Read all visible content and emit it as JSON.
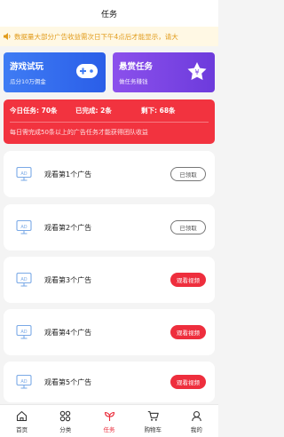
{
  "header": {
    "title": "任务"
  },
  "notice": {
    "text": "数据量大部分广告收益需次日下午4点后才能显示，请大"
  },
  "cards": [
    {
      "title": "游戏试玩",
      "subtitle": "瓜分10万佣金",
      "icon": "gamepad-icon",
      "color": "#3f7cf4"
    },
    {
      "title": "悬赏任务",
      "subtitle": "做任务赚钱",
      "icon": "yen-star-icon",
      "color": "#8b50ec"
    }
  ],
  "stats": {
    "today": "今日任务: 70条",
    "done": "已完成: 2条",
    "left": "剩下: 68条",
    "desc": "每日需完成50条以上的广告任务才能获得团队收益"
  },
  "tasks": [
    {
      "label": "观看第1个广告",
      "button": "已领取",
      "state": "claimed"
    },
    {
      "label": "观看第2个广告",
      "button": "已领取",
      "state": "claimed"
    },
    {
      "label": "观看第3个广告",
      "button": "观看视频",
      "state": "watch"
    },
    {
      "label": "观看第4个广告",
      "button": "观看视频",
      "state": "watch"
    },
    {
      "label": "观看第5个广告",
      "button": "观看视频",
      "state": "watch"
    }
  ],
  "tabbar": [
    {
      "label": "首页",
      "icon": "home-icon"
    },
    {
      "label": "分类",
      "icon": "category-icon"
    },
    {
      "label": "任务",
      "icon": "task-icon",
      "active": true
    },
    {
      "label": "购物车",
      "icon": "cart-icon"
    },
    {
      "label": "我的",
      "icon": "profile-icon"
    }
  ],
  "colors": {
    "accent": "#ea2b3a",
    "notice": "#e19b1b",
    "monitor": "#7aa9e6"
  }
}
